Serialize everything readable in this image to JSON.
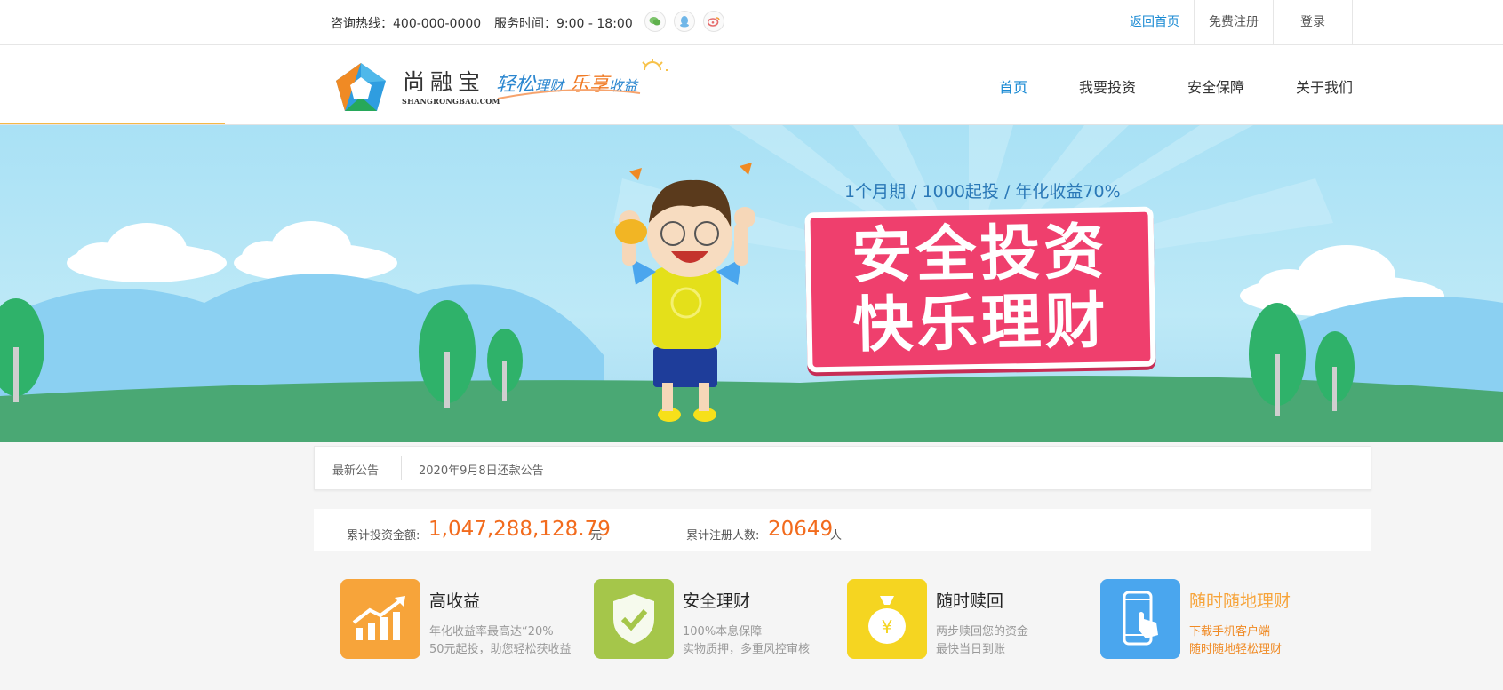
{
  "topbar": {
    "hotline": "咨询热线：400-000-0000",
    "service_time": "服务时间：9:00 - 18:00",
    "social_icons": [
      "wechat-icon",
      "qq-icon",
      "weibo-icon"
    ],
    "links": [
      {
        "label": "返回首页",
        "active": true
      },
      {
        "label": "免费注册",
        "active": false
      },
      {
        "label": "登录",
        "active": false
      }
    ]
  },
  "header": {
    "logo_name": "尚融宝",
    "logo_domain": "SHANGRONGBAO.COM",
    "slogan_part1": "轻松",
    "slogan_part2": "理财",
    "slogan_part3": "乐享",
    "slogan_part4": "收益",
    "nav": [
      {
        "label": "首页",
        "active": true
      },
      {
        "label": "我要投资",
        "active": false
      },
      {
        "label": "安全保障",
        "active": false
      },
      {
        "label": "关于我们",
        "active": false
      }
    ]
  },
  "banner": {
    "subtitle": "1个月期 / 1000起投 / 年化收益70%",
    "title_line1": "安全投资",
    "title_line2": "快乐理财"
  },
  "notice": {
    "label": "最新公告",
    "item": "2020年9月8日还款公告"
  },
  "stats": {
    "invest_label": "累计投资金额:",
    "invest_value": "1,047,288,128.79",
    "invest_unit": "元",
    "register_label": "累计注册人数:",
    "register_value": "20649",
    "register_unit": "人"
  },
  "features": [
    {
      "icon": "chart-up-icon",
      "title": "高收益",
      "line1": "年化收益率最高达“20%",
      "line2": "50元起投，助您轻松获收益",
      "color": "#f7a43a"
    },
    {
      "icon": "shield-check-icon",
      "title": "安全理财",
      "line1": "100%本息保障",
      "line2": "实物质押，多重风控审核",
      "color": "#a5c64a"
    },
    {
      "icon": "money-bag-icon",
      "title": "随时赎回",
      "line1": "两步赎回您的资金",
      "line2": "最快当日到账",
      "color": "#f5d521"
    },
    {
      "icon": "mobile-touch-icon",
      "title": "随时随地理财",
      "line1": "下载手机客户端",
      "line2": "随时随地轻松理财",
      "color": "#4aa6ee"
    }
  ],
  "colors": {
    "accent_blue": "#1a8ad3",
    "accent_orange": "#f26b1d",
    "banner_pink": "#ef3f6d"
  }
}
